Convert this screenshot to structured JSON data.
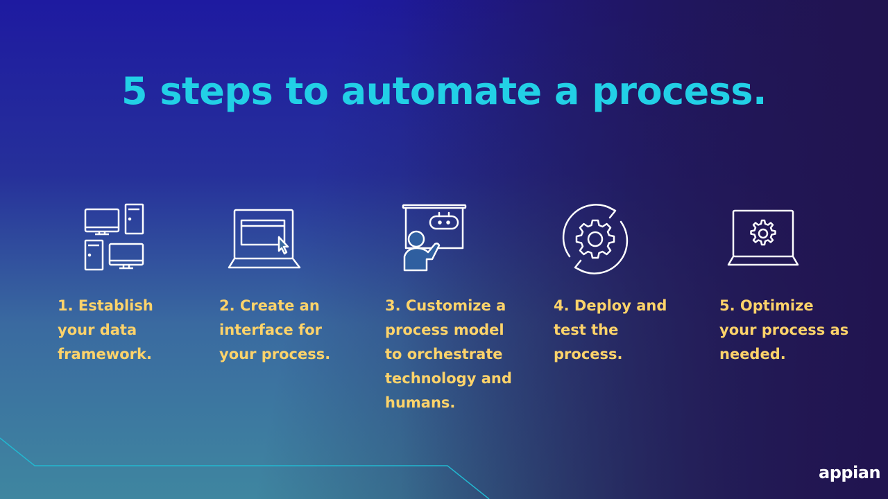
{
  "title": "5 steps to automate a process.",
  "steps": [
    {
      "label": "1. Establish your data framework.",
      "icon": "computers-network-icon"
    },
    {
      "label": "2. Create an interface for your process.",
      "icon": "laptop-interface-cursor-icon"
    },
    {
      "label": "3. Customize a process model to orchestrate technology and humans.",
      "icon": "person-robot-presentation-icon"
    },
    {
      "label": "4. Deploy and test the process.",
      "icon": "gear-cycle-icon"
    },
    {
      "label": "5. Optimize your process as needed.",
      "icon": "laptop-gear-icon"
    }
  ],
  "logo": "appian",
  "colors": {
    "title": "#22d0e6",
    "step_label": "#fdd36a",
    "icon_stroke": "#ffffff",
    "accent_line": "#22b8d0"
  }
}
